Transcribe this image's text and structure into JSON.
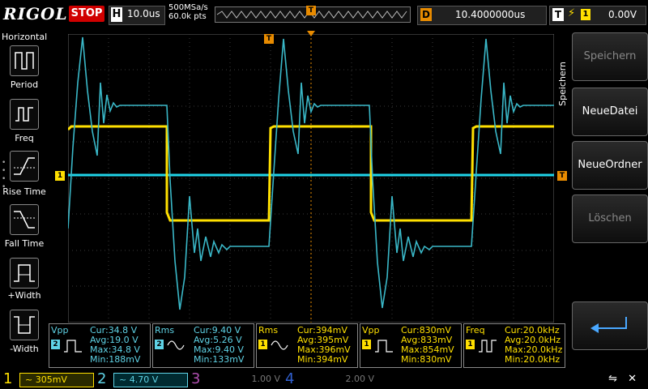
{
  "header": {
    "brand": "RIGOL",
    "run_state": "STOP",
    "timebase_letter": "H",
    "timebase": "10.0us",
    "sample_rate": "500MSa/s",
    "memory_depth": "60.0k pts",
    "trig_marker": "T",
    "delay_letter": "D",
    "delay": "10.4000000us",
    "trigger_letter": "T",
    "trigger_edge": "⚡",
    "trigger_channel": "1",
    "trigger_level": "0.00V"
  },
  "left_menu": {
    "title": "Horizontal",
    "items": [
      {
        "label": "Period",
        "icon": "period-icon"
      },
      {
        "label": "Freq",
        "icon": "frequency-icon"
      },
      {
        "label": "Rise Time",
        "icon": "rise-time-icon"
      },
      {
        "label": "Fall Time",
        "icon": "fall-time-icon"
      },
      {
        "label": "+Width",
        "icon": "positive-width-icon"
      },
      {
        "label": "-Width",
        "icon": "negative-width-icon"
      }
    ]
  },
  "right_menu": {
    "title": "Speichern",
    "buttons": [
      {
        "label": "Speichern",
        "enabled": false
      },
      {
        "label": "NeueDatei",
        "enabled": true
      },
      {
        "label": "NeueOrdner",
        "enabled": true
      },
      {
        "label": "Löschen",
        "enabled": false
      },
      {
        "label": "",
        "icon": "enter-icon",
        "enabled": true
      }
    ]
  },
  "screen": {
    "ch1_marker": "1",
    "trigger_level_marker": "T",
    "trigger_pos_marker": "T"
  },
  "measurements": [
    {
      "name": "Vpp",
      "channel": "2",
      "cur": "Cur:34.8 V",
      "avg": "Avg:19.0 V",
      "max": "Max:34.8 V",
      "min": "Min:188mV"
    },
    {
      "name": "Rms",
      "channel": "2",
      "cur": "Cur:9.40 V",
      "avg": "Avg:5.26 V",
      "max": "Max:9.40 V",
      "min": "Min:133mV"
    },
    {
      "name": "Rms",
      "channel": "1",
      "cur": "Cur:394mV",
      "avg": "Avg:395mV",
      "max": "Max:396mV",
      "min": "Min:394mV"
    },
    {
      "name": "Vpp",
      "channel": "1",
      "cur": "Cur:830mV",
      "avg": "Avg:833mV",
      "max": "Max:854mV",
      "min": "Min:830mV"
    },
    {
      "name": "Freq",
      "channel": "1",
      "cur": "Cur:20.0kHz",
      "avg": "Avg:20.0kHz",
      "max": "Max:20.0kHz",
      "min": "Min:20.0kHz"
    }
  ],
  "channels": [
    {
      "num": "1",
      "coupling": "~",
      "scale": "305mV",
      "color": "#ffe000",
      "active": true
    },
    {
      "num": "2",
      "coupling": "~",
      "scale": "4.70 V",
      "color": "#5fd3e6",
      "active": true
    },
    {
      "num": "3",
      "coupling": "",
      "scale": "1.00 V",
      "color": "#b04fb0",
      "active": false
    },
    {
      "num": "4",
      "coupling": "",
      "scale": "2.00 V",
      "color": "#3060d0",
      "active": false
    }
  ],
  "status": {
    "usb": "usb-icon",
    "sound": "speaker-muted-icon"
  },
  "colors": {
    "ch1": "#ffe000",
    "ch2": "#5fd3e6",
    "accent": "#e88b00",
    "stop": "#d00000"
  }
}
